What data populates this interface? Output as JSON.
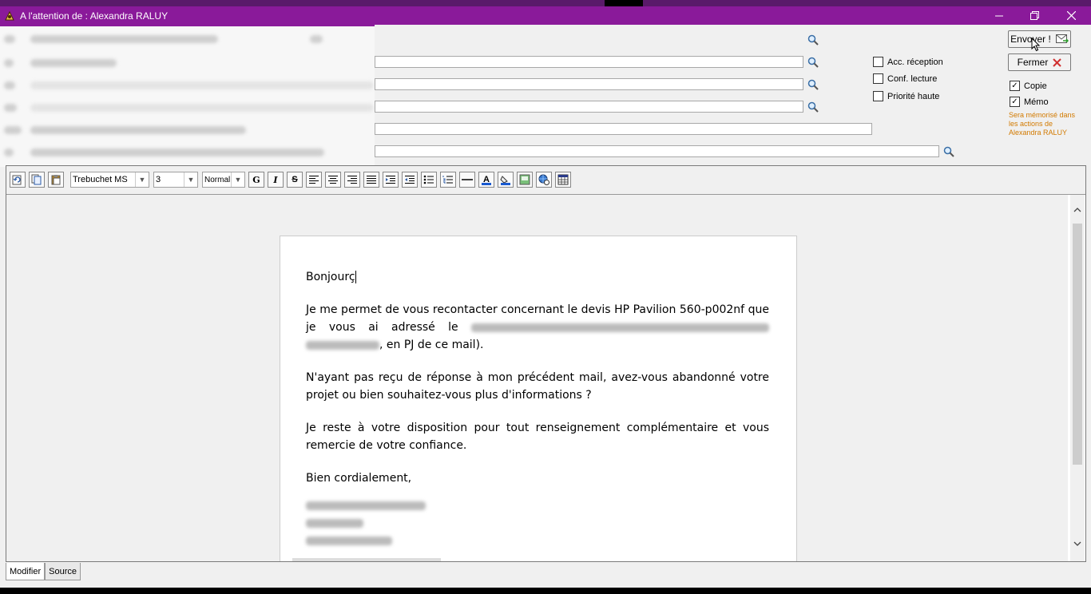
{
  "window": {
    "title": "A l'attention de : Alexandra RALUY",
    "accent_color": "#8a1a9a"
  },
  "actions": {
    "send_label": "Envoyer !",
    "close_label": "Fermer"
  },
  "options": {
    "ack_reception": {
      "label": "Acc. réception",
      "checked": false
    },
    "read_confirm": {
      "label": "Conf. lecture",
      "checked": false
    },
    "high_priority": {
      "label": "Priorité haute",
      "checked": false
    },
    "copy": {
      "label": "Copie",
      "checked": true
    },
    "memo": {
      "label": "Mémo",
      "checked": true
    },
    "memo_note": "Sera mémorisé dans les actions de Alexandra RALUY"
  },
  "toolbar": {
    "font_family": "Trebuchet MS",
    "font_size": "3",
    "paragraph_style": "Normal",
    "bold_icon": "G",
    "italic_icon": "I",
    "strike_icon": "S"
  },
  "message": {
    "greeting": "Bonjourç",
    "para1_a": "Je me permet de vous recontacter concernant le devis HP Pavilion 560-p002nf que je vous ai adressé le",
    "para1_b": ", en PJ de ce mail).",
    "para2": "N'ayant pas reçu de réponse à mon précédent mail, avez-vous abandonné votre projet ou bien souhaitez-vous plus d'informations ?",
    "para3": "Je reste à votre disposition pour tout renseignement complémentaire et vous remercie de votre confiance.",
    "closing": "Bien cordialement,"
  },
  "tabs": {
    "edit": "Modifier",
    "source": "Source"
  }
}
